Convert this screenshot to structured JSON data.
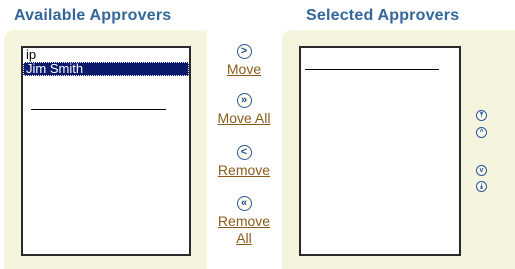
{
  "headings": {
    "available": "Available Approvers",
    "selected": "Selected Approvers"
  },
  "available_list": {
    "items": [
      {
        "label": "ip",
        "selected": false
      },
      {
        "label": "Jim Smith",
        "selected": true
      }
    ]
  },
  "selected_list": {
    "items": []
  },
  "move_controls": {
    "move": {
      "label": "Move",
      "icon": "move-right-icon",
      "glyph": ">"
    },
    "move_all": {
      "label": "Move All",
      "icon": "move-all-right-icon",
      "glyph": "»"
    },
    "remove": {
      "label": "Remove",
      "icon": "move-left-icon",
      "glyph": "<"
    },
    "remove_all_line1": "Remove",
    "remove_all_line2": "All",
    "remove_all_icon": {
      "icon": "move-all-left-icon",
      "glyph": "«"
    }
  },
  "order_controls": {
    "top": {
      "icon": "move-to-top-icon",
      "glyph": "⤒"
    },
    "up": {
      "icon": "move-up-icon",
      "glyph": "^"
    },
    "down": {
      "icon": "move-down-icon",
      "glyph": "v"
    },
    "bottom": {
      "icon": "move-to-bottom-icon",
      "glyph": "⤓"
    }
  },
  "colors": {
    "heading": "#336699",
    "panel": "#f5f4df",
    "selection": "#0b1a6b",
    "link": "#8a5c1c"
  }
}
